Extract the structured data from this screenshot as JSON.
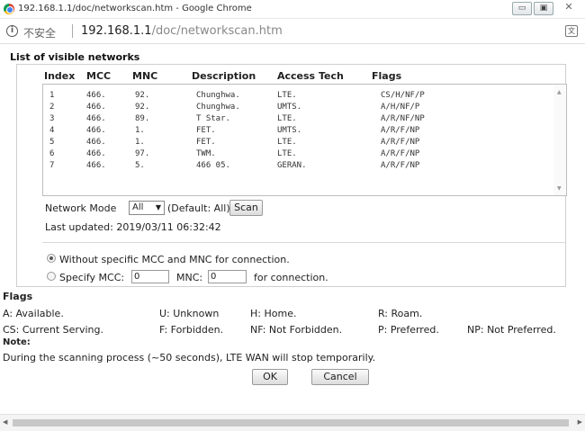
{
  "window": {
    "title": "192.168.1.1/doc/networkscan.htm - Google Chrome",
    "min_glyph": "▭",
    "max_glyph": "▣",
    "close_glyph": "✕"
  },
  "address_bar": {
    "info_glyph": "i",
    "insecure_label": "不安全",
    "url_host": "192.168.1.1",
    "url_path": "/doc/networkscan.htm",
    "translate_glyph": "文"
  },
  "heading": "List of visible networks",
  "table": {
    "columns": [
      "Index",
      "MCC",
      "MNC",
      "Description",
      "Access Tech",
      "Flags"
    ],
    "rows": [
      [
        "1",
        "466.",
        "92.",
        "Chunghwa.",
        "LTE.",
        "CS/H/NF/P"
      ],
      [
        "2",
        "466.",
        "92.",
        "Chunghwa.",
        "UMTS.",
        "A/H/NF/P"
      ],
      [
        "3",
        "466.",
        "89.",
        "T Star.",
        "LTE.",
        "A/R/NF/NP"
      ],
      [
        "4",
        "466.",
        "1.",
        "FET.",
        "UMTS.",
        "A/R/F/NP"
      ],
      [
        "5",
        "466.",
        "1.",
        "FET.",
        "LTE.",
        "A/R/F/NP"
      ],
      [
        "6",
        "466.",
        "97.",
        "TWM.",
        "LTE.",
        "A/R/F/NP"
      ],
      [
        "7",
        "466.",
        "5.",
        "466 05.",
        "GERAN.",
        "A/R/F/NP"
      ]
    ]
  },
  "network_mode": {
    "label": "Network Mode",
    "selected": "All",
    "default_text": "(Default: All)",
    "scan_label": "Scan"
  },
  "last_updated": "Last updated: 2019/03/11 06:32:42",
  "options": {
    "without_label": "Without specific MCC and MNC for connection.",
    "specify_label": "Specify MCC:",
    "mcc_value": "0",
    "mnc_label": "MNC:",
    "mnc_value": "0",
    "for_label": "for connection.",
    "selected": "without"
  },
  "flags": {
    "title": "Flags",
    "items": [
      "A: Available.",
      "U: Unknown",
      "H: Home.",
      "R: Roam.",
      "CS: Current Serving.",
      "F: Forbidden.",
      "NF: Not Forbidden.",
      "P: Preferred.",
      "NP: Not Preferred."
    ]
  },
  "note": {
    "title": "Note:",
    "text": "During the scanning process (~50 seconds), LTE WAN will stop temporarily."
  },
  "buttons": {
    "ok": "OK",
    "cancel": "Cancel"
  }
}
